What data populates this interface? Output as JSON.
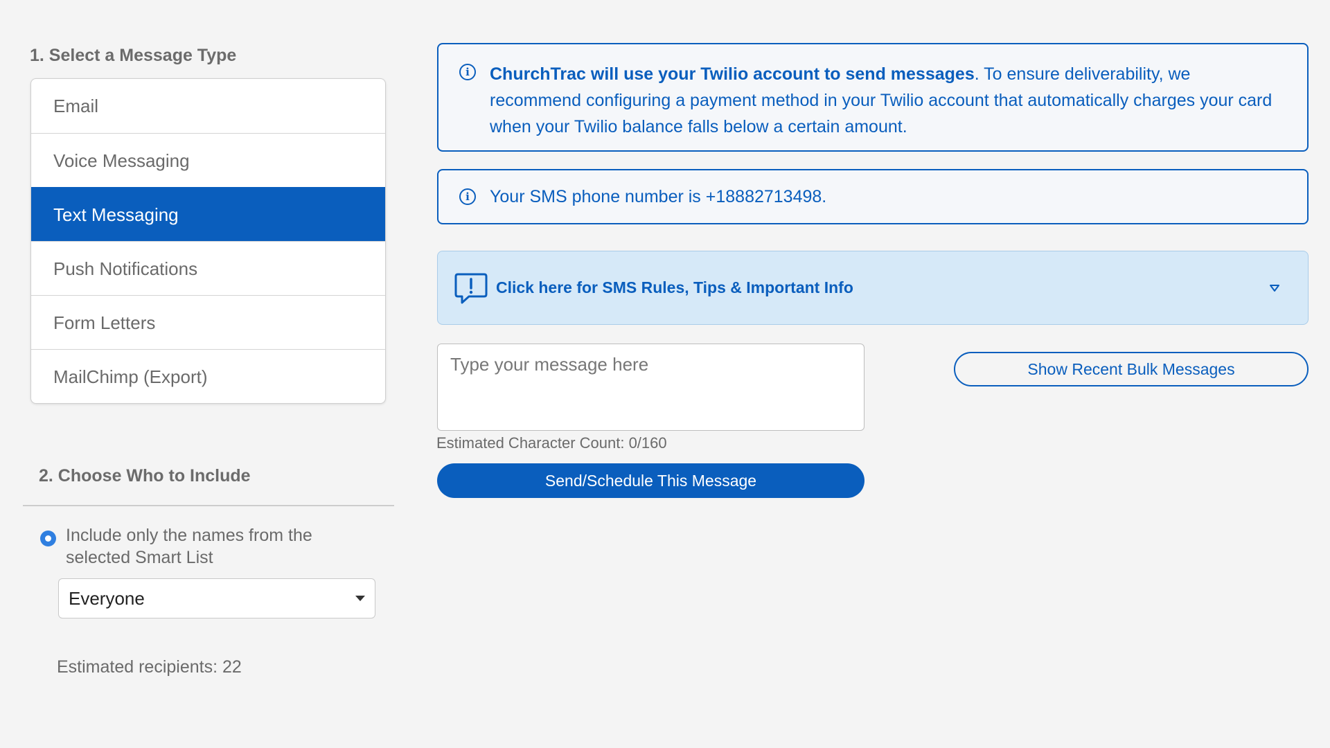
{
  "step1": {
    "title": "1. Select a Message Type",
    "items": [
      {
        "label": "Email"
      },
      {
        "label": "Voice Messaging"
      },
      {
        "label": "Text Messaging"
      },
      {
        "label": "Push Notifications"
      },
      {
        "label": "Form Letters"
      },
      {
        "label": "MailChimp (Export)"
      }
    ],
    "selected": "Text Messaging"
  },
  "step2": {
    "title": "2. Choose Who to Include",
    "radio_label": "Include only the names from the selected Smart List",
    "smart_list_value": "Everyone",
    "recipients": "Estimated recipients: 22"
  },
  "info_twilio": {
    "bold": "ChurchTrac will use your Twilio account to send messages",
    "rest": ". To ensure deliverability, we recommend configuring a payment method in your Twilio account that automatically charges your card when your Twilio balance falls below a certain amount."
  },
  "info_sms": {
    "text": "Your SMS phone number is +18882713498."
  },
  "tips": {
    "label": "Click here for SMS Rules, Tips & Important Info"
  },
  "composer": {
    "placeholder": "Type your message here",
    "value": "",
    "char_count": "Estimated Character Count: 0/160",
    "send_label": "Send/Schedule This Message",
    "recent_label": "Show Recent Bulk Messages"
  },
  "icons": {
    "info": "info-icon",
    "tips": "speech-bubble-exclamation-icon",
    "chevron": "chevron-down-icon",
    "dropdown": "caret-down-icon"
  },
  "colors": {
    "accent": "#0a5ebd",
    "tips_background": "#d6e9f8",
    "radio": "#2f7fe0",
    "page_background": "#f4f4f4"
  }
}
